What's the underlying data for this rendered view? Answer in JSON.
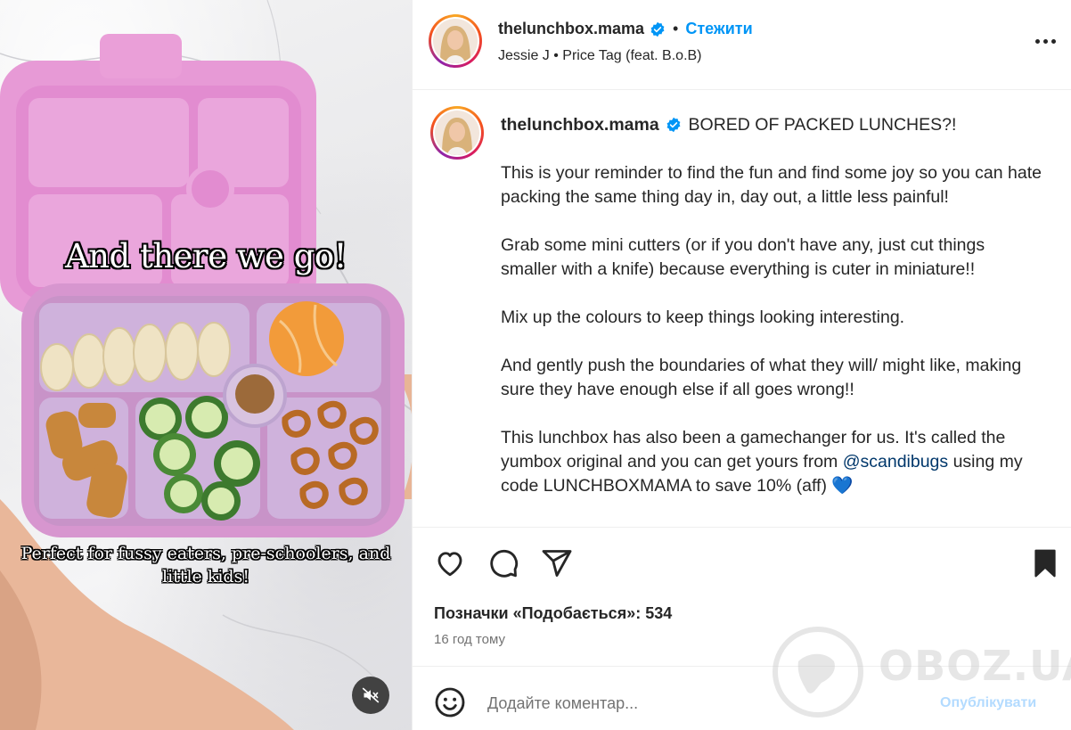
{
  "media": {
    "overlay_top": "And there we go!",
    "overlay_bottom": "Perfect for fussy eaters, pre-schoolers, and little kids!",
    "mute_icon": "speaker-muted-icon"
  },
  "header": {
    "username": "thelunchbox.mama",
    "verified_icon": "verified-badge-icon",
    "separator": "•",
    "follow_label": "Стежити",
    "audio": "Jessie J • Price Tag (feat. B.o.B)",
    "more_icon": "more-options-icon"
  },
  "caption": {
    "username": "thelunchbox.mama",
    "headline": "BORED OF PACKED LUNCHES?!",
    "paragraphs": [
      "This is your reminder to find the fun and find some joy so you can hate packing the same thing day in, day out, a little less painful!",
      "Grab some mini cutters (or if you don't have any, just cut things smaller with a knife) because everything is cuter in miniature!!",
      "Mix up the colours to keep things looking interesting.",
      "And gently push the boundaries of what they will/ might like, making sure they have enough else if all goes wrong!!"
    ],
    "last_before": "This lunchbox has also been a gamechanger for us. It's called the yumbox original and you can get yours from ",
    "mention": "@scandibugs",
    "last_after": " using my code LUNCHBOXMAMA to save 10% (aff) ",
    "heart_emoji": "💙"
  },
  "actions": {
    "like_icon": "heart-icon",
    "comment_icon": "comment-icon",
    "share_icon": "share-icon",
    "save_icon": "bookmark-icon",
    "likes": "Позначки «Подобається»: 534",
    "time": "16 год тому"
  },
  "comment": {
    "emoji_icon": "emoji-icon",
    "placeholder": "Додайте коментар...",
    "publish_label": "Опублікувати"
  },
  "watermark": {
    "text": "OBOZ.UA"
  },
  "colors": {
    "accent": "#0095f6",
    "publish_disabled": "#b3dbff",
    "lunchbox_pink": "#e8a0d8"
  }
}
